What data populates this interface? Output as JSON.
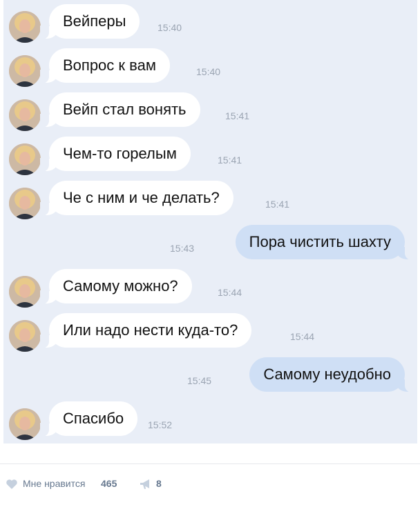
{
  "messages": [
    {
      "side": "in",
      "text": "Вейперы",
      "time": "15:40"
    },
    {
      "side": "in",
      "text": "Вопрос к вам",
      "time": "15:40"
    },
    {
      "side": "in",
      "text": "Вейп стал вонять",
      "time": "15:41"
    },
    {
      "side": "in",
      "text": "Чем-то горелым",
      "time": "15:41"
    },
    {
      "side": "in",
      "text": "Че с ним и че делать?",
      "time": "15:41"
    },
    {
      "side": "out",
      "text": "Пора чистить шахту",
      "time": "15:43"
    },
    {
      "side": "in",
      "text": "Самому можно?",
      "time": "15:44"
    },
    {
      "side": "in",
      "text": "Или надо нести куда-то?",
      "time": "15:44"
    },
    {
      "side": "out",
      "text": "Самому неудобно",
      "time": "15:45"
    },
    {
      "side": "in",
      "text": "Спасибо",
      "time": "15:52"
    }
  ],
  "footer": {
    "like_label": "Мне нравится",
    "like_count": "465",
    "share_count": "8",
    "like_icon": "heart-icon",
    "share_icon": "megaphone-icon"
  },
  "colors": {
    "chat_bg": "#e9eef7",
    "incoming_bubble": "#ffffff",
    "outgoing_bubble": "#cfdff5",
    "time_text": "#9aa4b2",
    "footer_text": "#66788f"
  }
}
